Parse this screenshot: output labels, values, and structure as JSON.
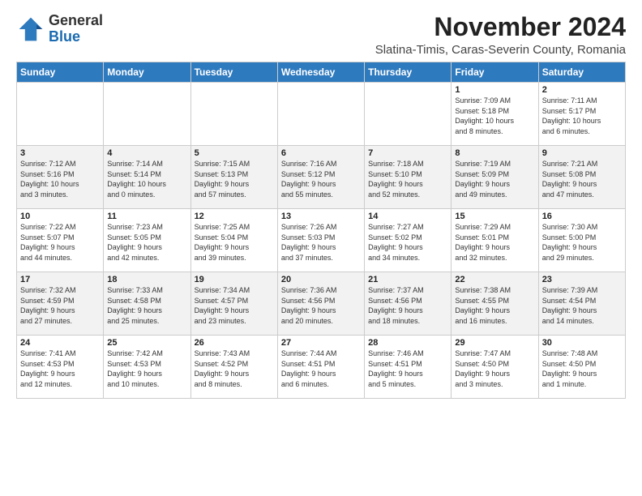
{
  "header": {
    "logo_general": "General",
    "logo_blue": "Blue",
    "month_title": "November 2024",
    "location": "Slatina-Timis, Caras-Severin County, Romania"
  },
  "weekdays": [
    "Sunday",
    "Monday",
    "Tuesday",
    "Wednesday",
    "Thursday",
    "Friday",
    "Saturday"
  ],
  "weeks": [
    [
      {
        "day": "",
        "info": ""
      },
      {
        "day": "",
        "info": ""
      },
      {
        "day": "",
        "info": ""
      },
      {
        "day": "",
        "info": ""
      },
      {
        "day": "",
        "info": ""
      },
      {
        "day": "1",
        "info": "Sunrise: 7:09 AM\nSunset: 5:18 PM\nDaylight: 10 hours\nand 8 minutes."
      },
      {
        "day": "2",
        "info": "Sunrise: 7:11 AM\nSunset: 5:17 PM\nDaylight: 10 hours\nand 6 minutes."
      }
    ],
    [
      {
        "day": "3",
        "info": "Sunrise: 7:12 AM\nSunset: 5:16 PM\nDaylight: 10 hours\nand 3 minutes."
      },
      {
        "day": "4",
        "info": "Sunrise: 7:14 AM\nSunset: 5:14 PM\nDaylight: 10 hours\nand 0 minutes."
      },
      {
        "day": "5",
        "info": "Sunrise: 7:15 AM\nSunset: 5:13 PM\nDaylight: 9 hours\nand 57 minutes."
      },
      {
        "day": "6",
        "info": "Sunrise: 7:16 AM\nSunset: 5:12 PM\nDaylight: 9 hours\nand 55 minutes."
      },
      {
        "day": "7",
        "info": "Sunrise: 7:18 AM\nSunset: 5:10 PM\nDaylight: 9 hours\nand 52 minutes."
      },
      {
        "day": "8",
        "info": "Sunrise: 7:19 AM\nSunset: 5:09 PM\nDaylight: 9 hours\nand 49 minutes."
      },
      {
        "day": "9",
        "info": "Sunrise: 7:21 AM\nSunset: 5:08 PM\nDaylight: 9 hours\nand 47 minutes."
      }
    ],
    [
      {
        "day": "10",
        "info": "Sunrise: 7:22 AM\nSunset: 5:07 PM\nDaylight: 9 hours\nand 44 minutes."
      },
      {
        "day": "11",
        "info": "Sunrise: 7:23 AM\nSunset: 5:05 PM\nDaylight: 9 hours\nand 42 minutes."
      },
      {
        "day": "12",
        "info": "Sunrise: 7:25 AM\nSunset: 5:04 PM\nDaylight: 9 hours\nand 39 minutes."
      },
      {
        "day": "13",
        "info": "Sunrise: 7:26 AM\nSunset: 5:03 PM\nDaylight: 9 hours\nand 37 minutes."
      },
      {
        "day": "14",
        "info": "Sunrise: 7:27 AM\nSunset: 5:02 PM\nDaylight: 9 hours\nand 34 minutes."
      },
      {
        "day": "15",
        "info": "Sunrise: 7:29 AM\nSunset: 5:01 PM\nDaylight: 9 hours\nand 32 minutes."
      },
      {
        "day": "16",
        "info": "Sunrise: 7:30 AM\nSunset: 5:00 PM\nDaylight: 9 hours\nand 29 minutes."
      }
    ],
    [
      {
        "day": "17",
        "info": "Sunrise: 7:32 AM\nSunset: 4:59 PM\nDaylight: 9 hours\nand 27 minutes."
      },
      {
        "day": "18",
        "info": "Sunrise: 7:33 AM\nSunset: 4:58 PM\nDaylight: 9 hours\nand 25 minutes."
      },
      {
        "day": "19",
        "info": "Sunrise: 7:34 AM\nSunset: 4:57 PM\nDaylight: 9 hours\nand 23 minutes."
      },
      {
        "day": "20",
        "info": "Sunrise: 7:36 AM\nSunset: 4:56 PM\nDaylight: 9 hours\nand 20 minutes."
      },
      {
        "day": "21",
        "info": "Sunrise: 7:37 AM\nSunset: 4:56 PM\nDaylight: 9 hours\nand 18 minutes."
      },
      {
        "day": "22",
        "info": "Sunrise: 7:38 AM\nSunset: 4:55 PM\nDaylight: 9 hours\nand 16 minutes."
      },
      {
        "day": "23",
        "info": "Sunrise: 7:39 AM\nSunset: 4:54 PM\nDaylight: 9 hours\nand 14 minutes."
      }
    ],
    [
      {
        "day": "24",
        "info": "Sunrise: 7:41 AM\nSunset: 4:53 PM\nDaylight: 9 hours\nand 12 minutes."
      },
      {
        "day": "25",
        "info": "Sunrise: 7:42 AM\nSunset: 4:53 PM\nDaylight: 9 hours\nand 10 minutes."
      },
      {
        "day": "26",
        "info": "Sunrise: 7:43 AM\nSunset: 4:52 PM\nDaylight: 9 hours\nand 8 minutes."
      },
      {
        "day": "27",
        "info": "Sunrise: 7:44 AM\nSunset: 4:51 PM\nDaylight: 9 hours\nand 6 minutes."
      },
      {
        "day": "28",
        "info": "Sunrise: 7:46 AM\nSunset: 4:51 PM\nDaylight: 9 hours\nand 5 minutes."
      },
      {
        "day": "29",
        "info": "Sunrise: 7:47 AM\nSunset: 4:50 PM\nDaylight: 9 hours\nand 3 minutes."
      },
      {
        "day": "30",
        "info": "Sunrise: 7:48 AM\nSunset: 4:50 PM\nDaylight: 9 hours\nand 1 minute."
      }
    ]
  ]
}
